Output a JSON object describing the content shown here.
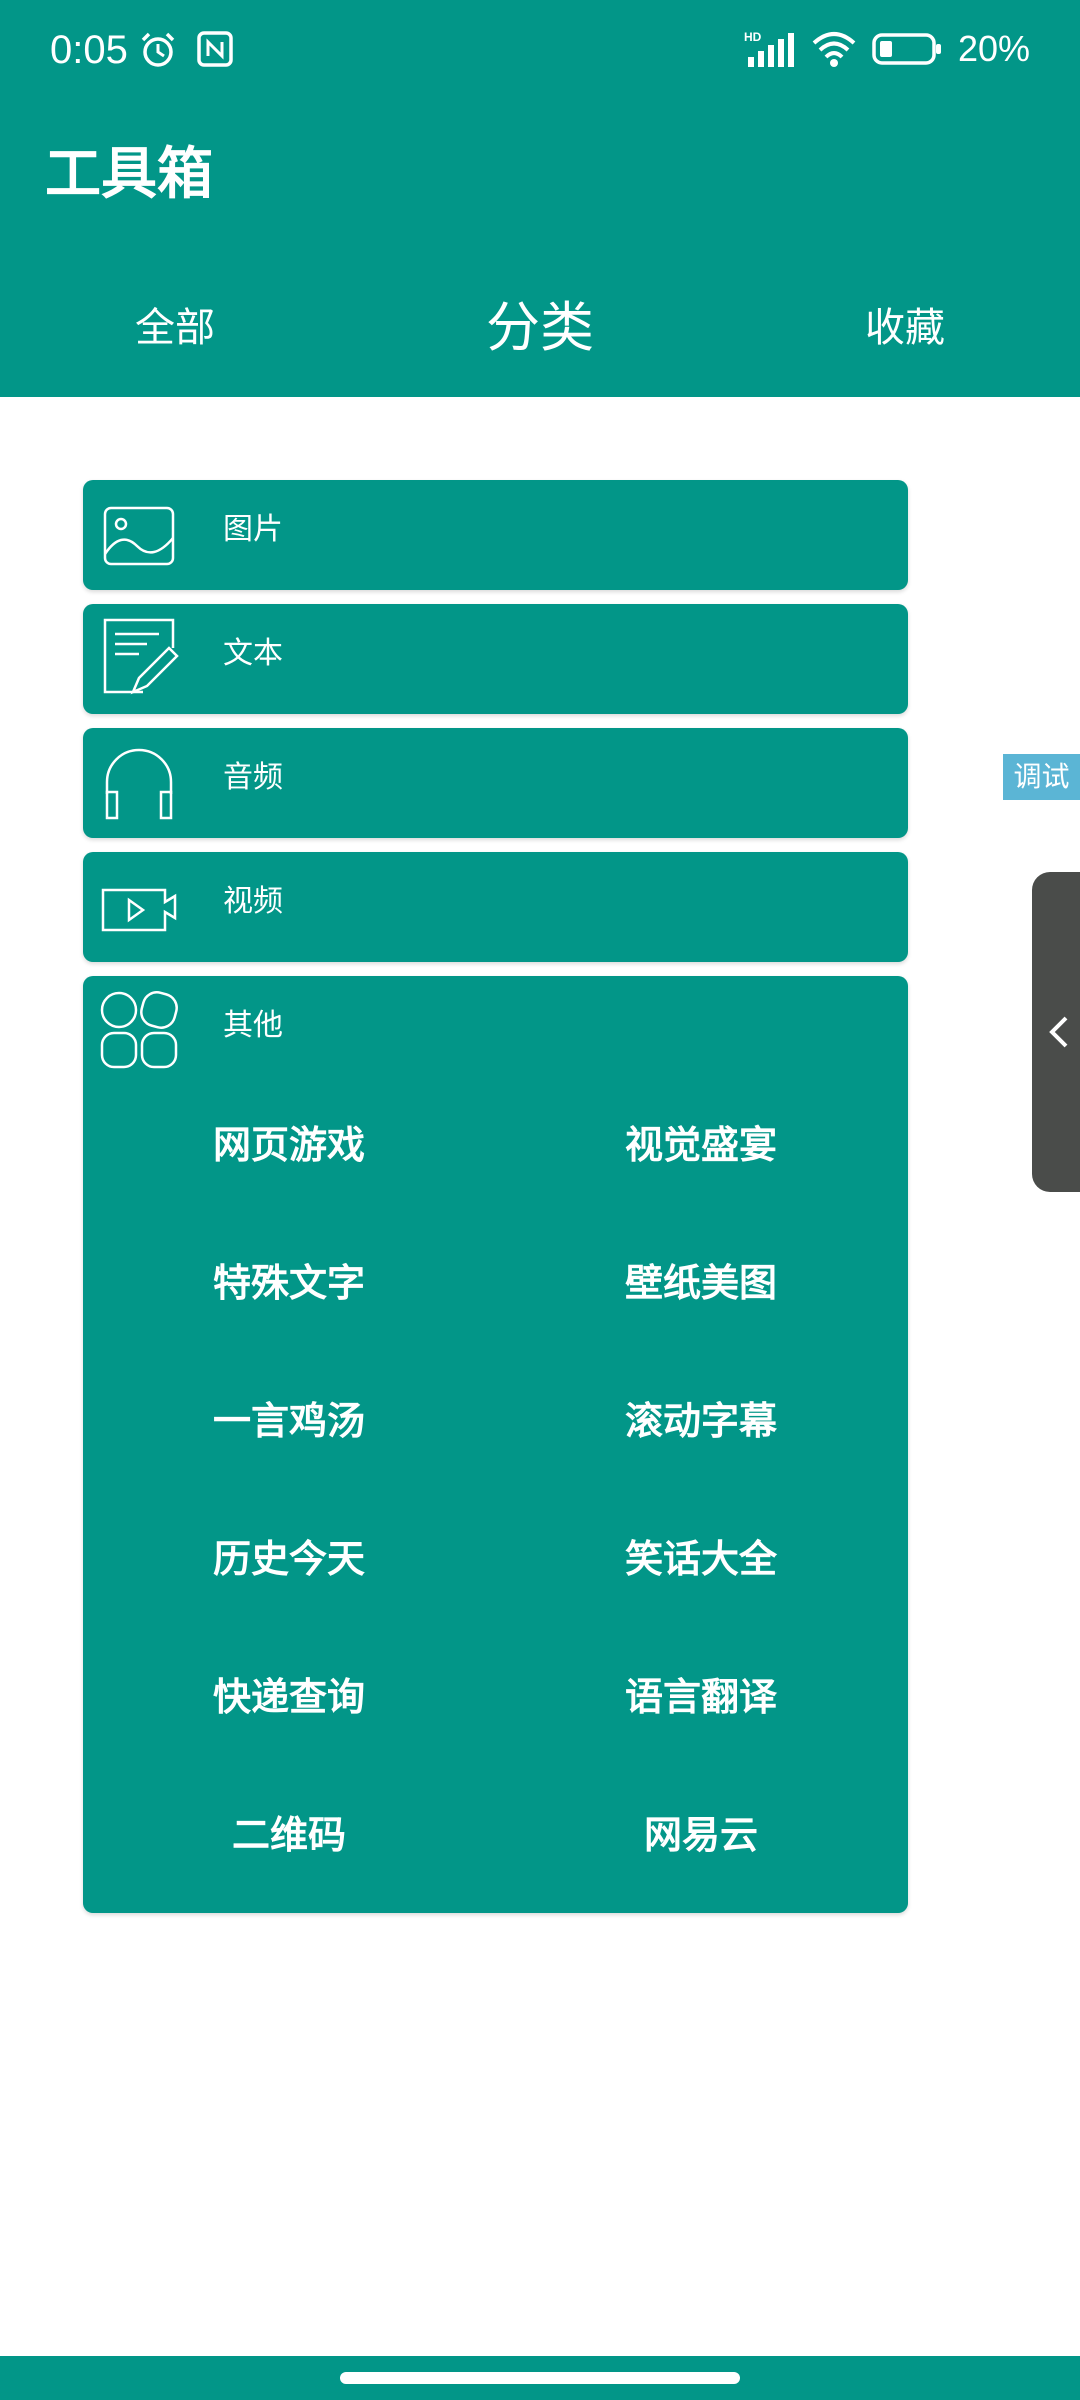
{
  "status_bar": {
    "time": "0:05",
    "battery": "20%"
  },
  "header": {
    "title": "工具箱"
  },
  "tabs": [
    {
      "label": "全部"
    },
    {
      "label": "分类"
    },
    {
      "label": "收藏"
    }
  ],
  "categories": [
    {
      "label": "图片",
      "icon": "image-icon"
    },
    {
      "label": "文本",
      "icon": "document-edit-icon"
    },
    {
      "label": "音频",
      "icon": "headphones-icon"
    },
    {
      "label": "视频",
      "icon": "video-icon"
    },
    {
      "label": "其他",
      "icon": "grid-icon"
    }
  ],
  "other_items": [
    "网页游戏",
    "视觉盛宴",
    "特殊文字",
    "壁纸美图",
    "一言鸡汤",
    "滚动字幕",
    "历史今天",
    "笑话大全",
    "快递查询",
    "语言翻译",
    "二维码",
    "网易云"
  ],
  "debug": {
    "label": "调试"
  },
  "colors": {
    "primary": "#029688",
    "debug_tag": "#5bb5d5",
    "side_handle": "#4a4c4a"
  }
}
